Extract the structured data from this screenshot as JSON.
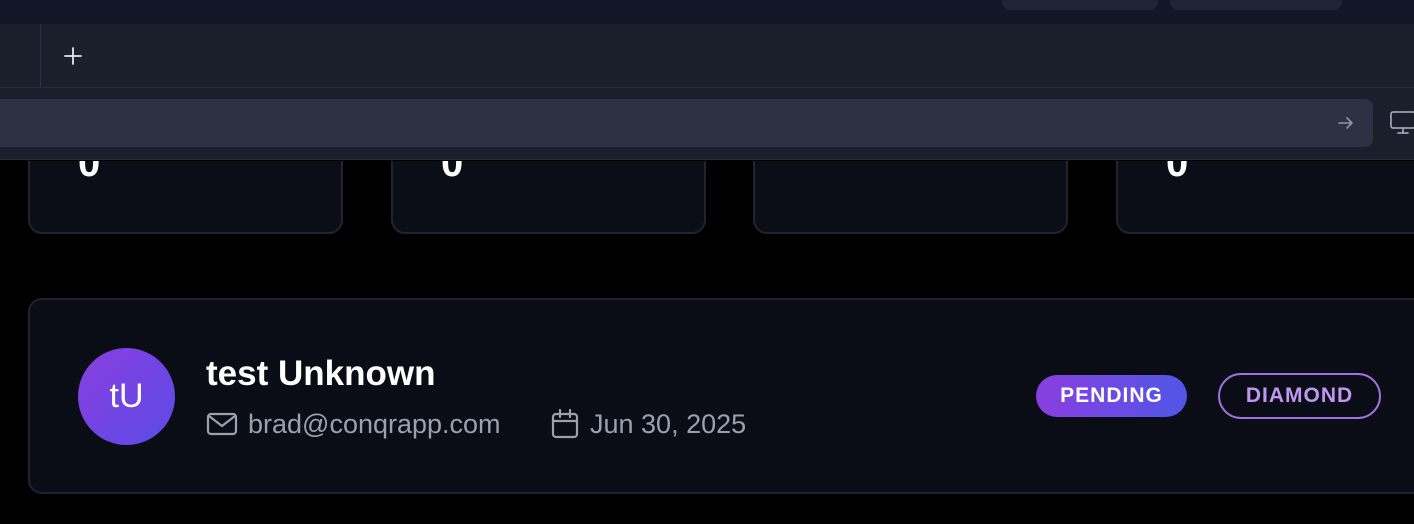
{
  "browser": {
    "new_tab_icon": "plus-icon",
    "address_bar": {
      "value": "",
      "placeholder": ""
    },
    "go_icon": "arrow-right-icon",
    "device_icon": "monitor-icon"
  },
  "stats": [
    {
      "value": "0"
    },
    {
      "value": "0"
    },
    {
      "value": ""
    },
    {
      "value": "0"
    }
  ],
  "user": {
    "initials": "tU",
    "name": "test Unknown",
    "email": "brad@conqrapp.com",
    "date": "Jun 30, 2025",
    "status": "PENDING",
    "tier": "DIAMOND"
  },
  "colors": {
    "background": "#000000",
    "card": "#0a0d15",
    "accent_purple": "#8a3ee0",
    "accent_blue": "#4f56e6",
    "tier_outline": "#a070dc"
  }
}
